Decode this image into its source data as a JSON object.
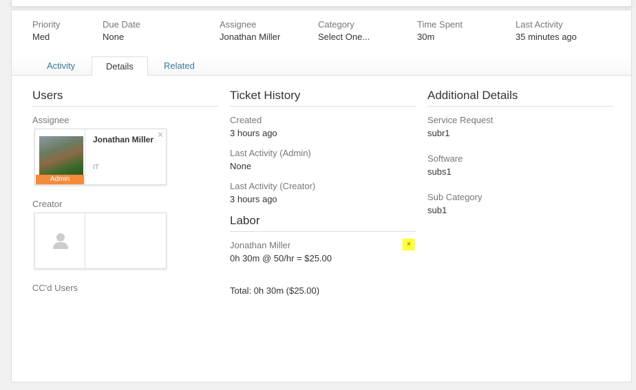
{
  "summary": [
    {
      "label": "Priority",
      "value": "Med"
    },
    {
      "label": "Due Date",
      "value": "None"
    },
    {
      "label": "Assignee",
      "value": "Jonathan Miller"
    },
    {
      "label": "Category",
      "value": "Select One..."
    },
    {
      "label": "Time Spent",
      "value": "30m"
    },
    {
      "label": "Last Activity",
      "value": "35 minutes ago"
    }
  ],
  "tabs": [
    "Activity",
    "Details",
    "Related"
  ],
  "users": {
    "title": "Users",
    "assignee_label": "Assignee",
    "assignee": {
      "name": "Jonathan Miller",
      "dept": "IT",
      "badge": "Admin"
    },
    "creator_label": "Creator",
    "cc_label": "CC'd Users"
  },
  "history": {
    "title": "Ticket History",
    "items": [
      {
        "label": "Created",
        "value": "3 hours ago"
      },
      {
        "label": "Last Activity (Admin)",
        "value": "None"
      },
      {
        "label": "Last Activity (Creator)",
        "value": "3 hours ago"
      }
    ]
  },
  "labor": {
    "title": "Labor",
    "name": "Jonathan Miller",
    "entry": "0h 30m @ 50/hr = $25.00",
    "total": "Total: 0h 30m ($25.00)",
    "remove": "×"
  },
  "additional": {
    "title": "Additional Details",
    "items": [
      {
        "label": "Service Request",
        "value": "subr1"
      },
      {
        "label": "Software",
        "value": "subs1"
      },
      {
        "label": "Sub Category",
        "value": "sub1"
      }
    ]
  }
}
